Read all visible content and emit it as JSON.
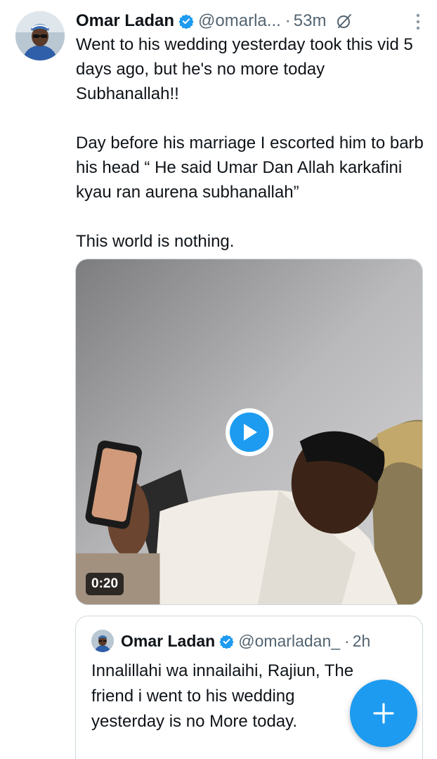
{
  "tweet": {
    "author_name": "Omar Ladan",
    "handle": "@omarla...",
    "separator": "·",
    "time": "53m",
    "text": "Went to his wedding yesterday took this vid 5 days ago, but he's no more today Subhanallah!!\n\nDay before his marriage I escorted him to barb his head “ He said Umar Dan Allah karkafini kyau ran aurena subhanallah”\n\nThis world is nothing.",
    "video": {
      "duration": "0:20"
    }
  },
  "quoted_tweet": {
    "author_name": "Omar Ladan",
    "handle": "@omarladan_",
    "separator": "·",
    "time": "2h",
    "text": "Innalillahi wa innailaihi, Rajiun, The friend i went to his wedding yesterday is no More today."
  },
  "icons": {
    "verified": "verified-badge-icon",
    "grok": "grok-icon",
    "more": "more-vertical-icon",
    "play": "play-icon",
    "compose": "plus-icon"
  },
  "colors": {
    "accent": "#1d9bf0",
    "text": "#0f1419",
    "muted": "#536471",
    "border": "#cfd9de"
  }
}
